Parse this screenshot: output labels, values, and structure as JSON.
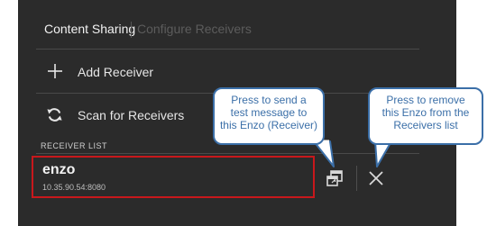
{
  "tabs": {
    "active": "Content Sharing",
    "inactive": "Configure Receivers"
  },
  "actions": {
    "add_receiver": "Add Receiver",
    "scan_receivers": "Scan for Receivers"
  },
  "receiver_list": {
    "title": "RECEIVER LIST",
    "items": [
      {
        "name": "enzo",
        "address": "10.35.90.54:8080"
      }
    ]
  },
  "callouts": {
    "send_test": "Press to send a\ntest message to\nthis Enzo (Receiver)",
    "remove": "Press to remove\nthis Enzo from the\nReceivers list"
  },
  "colors": {
    "panel_bg": "#2b2b2b",
    "selection_border": "#c8181c",
    "callout_border": "#3b6fa8"
  },
  "icons": {
    "add": "plus-icon",
    "scan": "refresh-icon",
    "send_test": "external-window-icon",
    "remove": "close-icon"
  }
}
